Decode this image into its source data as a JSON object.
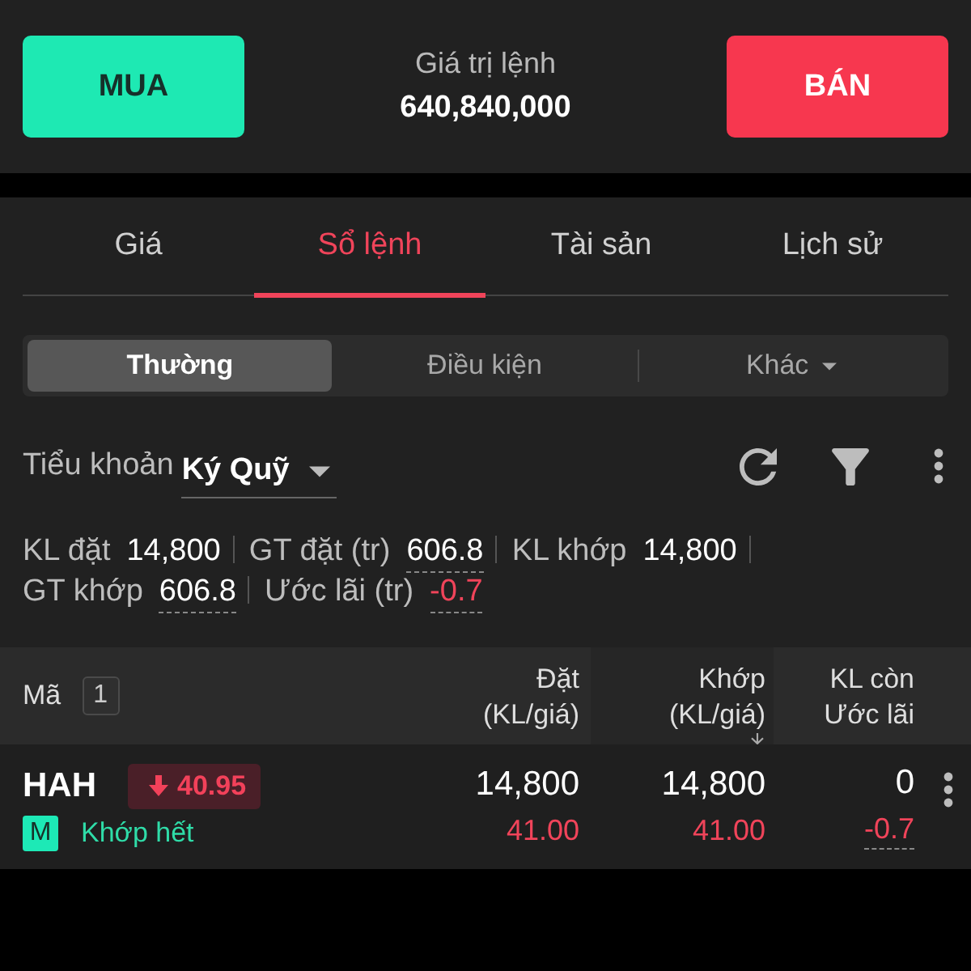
{
  "order_bar": {
    "buy_button": "MUA",
    "value_label": "Giá trị lệnh",
    "value": "640,840,000",
    "sell_button": "BÁN"
  },
  "tabs": [
    {
      "label": "Giá",
      "selected": false
    },
    {
      "label": "Sổ lệnh",
      "selected": true
    },
    {
      "label": "Tài sản",
      "selected": false
    },
    {
      "label": "Lịch sử",
      "selected": false
    }
  ],
  "order_types": [
    {
      "label": "Thường",
      "selected": true,
      "kind": "plain"
    },
    {
      "label": "Điều kiện",
      "selected": false,
      "kind": "plain"
    },
    {
      "label": "Khác",
      "selected": false,
      "kind": "dropdown"
    }
  ],
  "sub_account": {
    "label": "Tiểu khoản",
    "value": "Ký Quỹ"
  },
  "summary": [
    {
      "label": "KL đặt",
      "value": "14,800",
      "underlined": false,
      "negative": false
    },
    {
      "label": "GT đặt (tr)",
      "value": "606.8",
      "underlined": true,
      "negative": false
    },
    {
      "label": "KL khớp",
      "value": "14,800",
      "underlined": false,
      "negative": false
    },
    {
      "label": "GT khớp",
      "value": "606.8",
      "underlined": true,
      "negative": false
    },
    {
      "label": "Ước lãi (tr)",
      "value": "-0.7",
      "underlined": true,
      "negative": true
    }
  ],
  "table": {
    "columns": [
      {
        "lines": [
          "Mã"
        ],
        "count": "1",
        "sorted": false
      },
      {
        "lines": [
          "Đặt",
          "(KL/giá)"
        ],
        "sorted": false
      },
      {
        "lines": [
          "Khớp",
          "(KL/giá)"
        ],
        "sorted": true
      },
      {
        "lines": [
          "KL còn",
          "Ước lãi"
        ],
        "sorted": false
      }
    ],
    "rows": [
      {
        "symbol": "HAH",
        "last_price": "40.95",
        "last_price_down": true,
        "tag": "M",
        "status": "Khớp hết",
        "order_qty": "14,800",
        "order_price": "41.00",
        "match_qty": "14,800",
        "match_price": "41.00",
        "prices_down": true,
        "remaining_qty": "0",
        "est_profit": "-0.7",
        "profit_negative": true
      }
    ]
  }
}
